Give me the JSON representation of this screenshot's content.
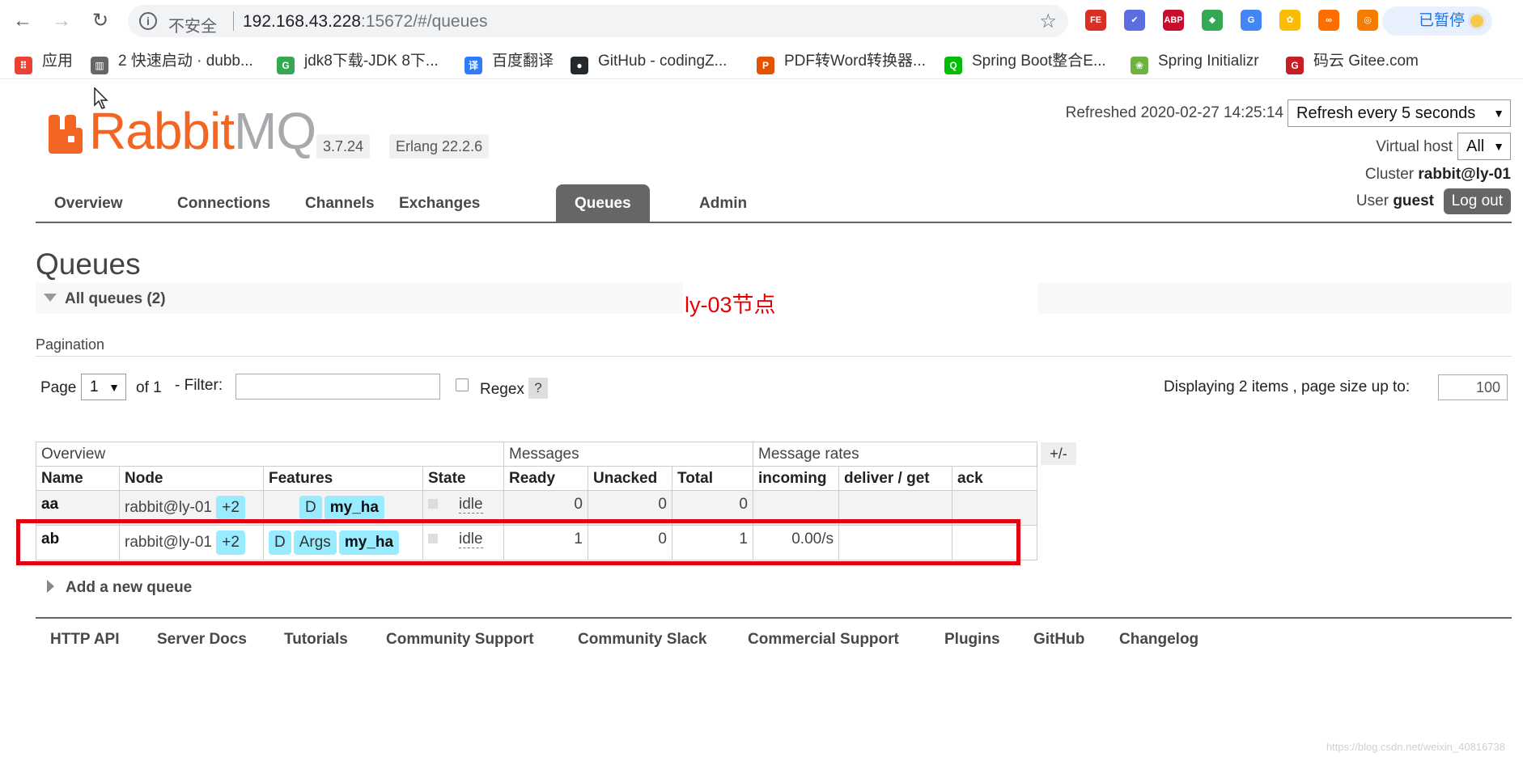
{
  "browser": {
    "insecure_label": "不安全",
    "url_host": "192.168.43.228",
    "url_rest": ":15672/#/queues",
    "paused_label": "已暂停",
    "extensions": [
      {
        "name": "fe-extension",
        "label": "FE",
        "color": "#d93025"
      },
      {
        "name": "check-extension",
        "label": "✔",
        "color": "#5b6ee1"
      },
      {
        "name": "abp-extension",
        "label": "ABP",
        "color": "#c70d2c"
      },
      {
        "name": "color-extension",
        "label": "◆",
        "color": "#34a853"
      },
      {
        "name": "translate-extension",
        "label": "G",
        "color": "#4285f4"
      },
      {
        "name": "photos-extension",
        "label": "✿",
        "color": "#fbbc05"
      },
      {
        "name": "infinity-extension",
        "label": "∞",
        "color": "#ff6d00"
      },
      {
        "name": "lifebuoy-extension",
        "label": "◎",
        "color": "#f57c00"
      }
    ]
  },
  "bookmarks": [
    {
      "label": "应用",
      "icon": "apps-grid-icon",
      "color": "#ea4335",
      "glyph": "⠿"
    },
    {
      "label": "2 快速启动 · dubb...",
      "icon": "book-icon",
      "color": "#666666",
      "glyph": "▥"
    },
    {
      "label": "jdk8下载-JDK 8下...",
      "icon": "g-leaf-icon",
      "color": "#34a853",
      "glyph": "G"
    },
    {
      "label": "百度翻译",
      "icon": "translate-icon",
      "color": "#2e7cf6",
      "glyph": "译"
    },
    {
      "label": "GitHub - codingZ...",
      "icon": "github-icon",
      "color": "#24292e",
      "glyph": "●"
    },
    {
      "label": "PDF转Word转换器...",
      "icon": "pdf-icon",
      "color": "#e65100",
      "glyph": "P"
    },
    {
      "label": "Spring Boot整合E...",
      "icon": "iqiyi-icon",
      "color": "#00be06",
      "glyph": "Q"
    },
    {
      "label": "Spring Initializr",
      "icon": "spring-icon",
      "color": "#6db33f",
      "glyph": "❀"
    },
    {
      "label": "码云 Gitee.com",
      "icon": "gitee-icon",
      "color": "#c71d23",
      "glyph": "G"
    }
  ],
  "header": {
    "logo_r": "Rabbit",
    "logo_mq": "MQ",
    "version": "3.7.24",
    "erlang": "Erlang 22.2.6",
    "refreshed": "Refreshed 2020-02-27 14:25:14",
    "refresh_select": "Refresh every 5 seconds",
    "vhost_label": "Virtual host",
    "vhost_value": "All",
    "cluster_label": "Cluster",
    "cluster_name": "rabbit@ly-01",
    "user_label": "User",
    "user_name": "guest",
    "logout": "Log out"
  },
  "tabs": [
    {
      "label": "Overview",
      "active": false
    },
    {
      "label": "Connections",
      "active": false
    },
    {
      "label": "Channels",
      "active": false
    },
    {
      "label": "Exchanges",
      "active": false
    },
    {
      "label": "Queues",
      "active": true
    },
    {
      "label": "Admin",
      "active": false
    }
  ],
  "page": {
    "title": "Queues",
    "section_title": "All queues (2)",
    "annotation": "ly-03节点",
    "pagination_label": "Pagination",
    "page_label": "Page",
    "page_value": "1",
    "of_label": "of 1",
    "filter_label": "- Filter:",
    "filter_value": "",
    "regex_label": "Regex",
    "help": "?",
    "displaying": "Displaying 2 items , page size up to:",
    "page_size": "100",
    "plus_minus": "+/-",
    "add_queue": "Add a new queue"
  },
  "table": {
    "groups": [
      "Overview",
      "Messages",
      "Message rates"
    ],
    "columns": [
      "Name",
      "Node",
      "Features",
      "State",
      "Ready",
      "Unacked",
      "Total",
      "incoming",
      "deliver / get",
      "ack"
    ],
    "rows": [
      {
        "name": "aa",
        "node": "rabbit@ly-01",
        "mirrors": "+2",
        "features": [
          "D"
        ],
        "policy": "my_ha",
        "state": "idle",
        "ready": "0",
        "unacked": "0",
        "total": "0",
        "incoming": "",
        "deliver": "",
        "ack": ""
      },
      {
        "name": "ab",
        "node": "rabbit@ly-01",
        "mirrors": "+2",
        "features": [
          "D",
          "Args"
        ],
        "policy": "my_ha",
        "state": "idle",
        "ready": "1",
        "unacked": "0",
        "total": "1",
        "incoming": "0.00/s",
        "deliver": "",
        "ack": ""
      }
    ]
  },
  "footer": [
    "HTTP API",
    "Server Docs",
    "Tutorials",
    "Community Support",
    "Community Slack",
    "Commercial Support",
    "Plugins",
    "GitHub",
    "Changelog"
  ],
  "watermark": "https://blog.csdn.net/weixin_40816738"
}
